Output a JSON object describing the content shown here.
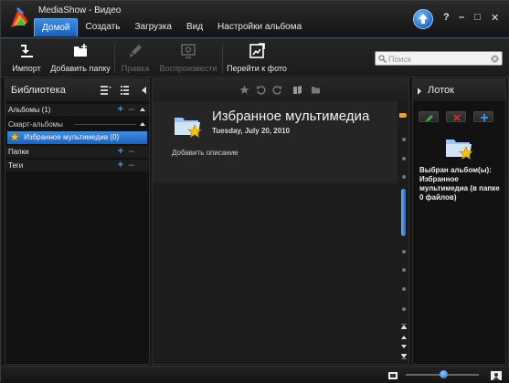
{
  "window": {
    "title": "MediaShow - Видео"
  },
  "menu": {
    "items": [
      "Домой",
      "Создать",
      "Загрузка",
      "Вид",
      "Настройки альбома"
    ],
    "active": "Домой"
  },
  "window_controls": {
    "help": "?",
    "minimize": "–",
    "maximize": "□",
    "close": "✕"
  },
  "toolbar": {
    "import_label": "Импорт",
    "add_folder_label": "Добавить папку",
    "edit_label": "Правка",
    "play_label": "Воспроизвести",
    "goto_photo_label": "Перейти к фото"
  },
  "search": {
    "placeholder": "Поиск",
    "value": ""
  },
  "library": {
    "title": "Библиотека",
    "albums_label": "Альбомы (1)",
    "smart_albums_label": "Смарт-альбомы",
    "selected_item_label": "Избранное мультимедиа (0)",
    "folders_label": "Папки",
    "tags_label": "Теги"
  },
  "album": {
    "title": "Избранное мультимедиа",
    "date": "Tuesday, July 20, 2010",
    "description_placeholder": "Добавить описание"
  },
  "tray": {
    "title": "Лоток",
    "info": "Выбран альбом(ы): Избранное мультимедиа (в папке 0 файлов)"
  },
  "colors": {
    "accent": "#2a7ad8",
    "star": "#f5c400",
    "folder": "#b8d4f0",
    "add_green": "#3ab54a",
    "delete_red": "#d03030"
  },
  "icons": {
    "library_view1": "list-view-icon",
    "library_view2": "detail-view-icon",
    "collapse": "collapse-left-icon"
  }
}
